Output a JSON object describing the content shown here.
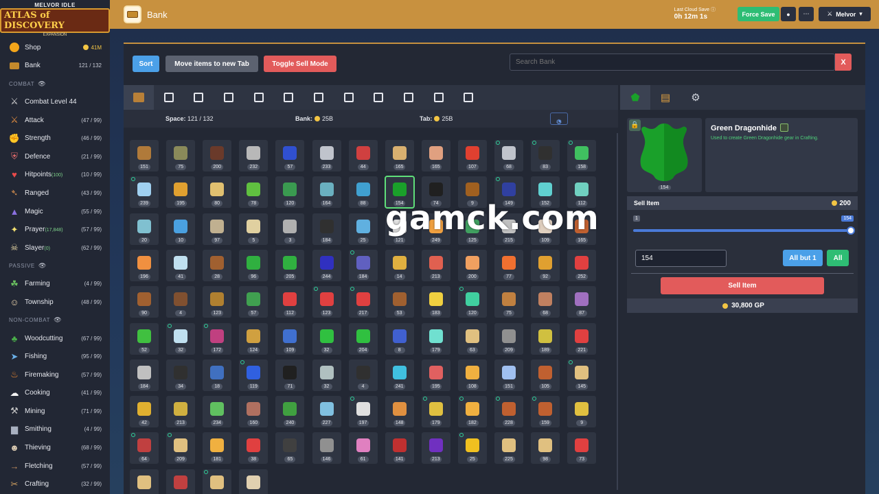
{
  "logo": {
    "top": "MELVOR IDLE",
    "main": "ATLAS of DISCOVERY",
    "sub": "EXPANSION"
  },
  "header": {
    "title": "Bank",
    "cloud_label": "Last Cloud Save",
    "cloud_time": "0h 12m 1s",
    "force_save": "Force Save",
    "menu_user": "Melvor"
  },
  "sidebar": {
    "shop": {
      "label": "Shop",
      "value": "41M"
    },
    "bank": {
      "label": "Bank",
      "value": "121 / 132"
    },
    "combat_head": "Combat",
    "combat_level": "Combat Level 44",
    "combat": [
      {
        "label": "Attack",
        "value": "(47 / 99)",
        "icon": "sword",
        "color": "#e89040"
      },
      {
        "label": "Strength",
        "value": "(46 / 99)",
        "icon": "arm",
        "color": "#f0b08a"
      },
      {
        "label": "Defence",
        "value": "(21 / 99)",
        "icon": "shield",
        "color": "#e06a6a"
      },
      {
        "label": "Hitpoints",
        "extra": "(100)",
        "value": "(10 / 99)",
        "icon": "heart",
        "color": "#e84a4a"
      },
      {
        "label": "Ranged",
        "value": "(43 / 99)",
        "icon": "bow",
        "color": "#d89050"
      },
      {
        "label": "Magic",
        "value": "(55 / 99)",
        "icon": "wizard",
        "color": "#8a70e0"
      },
      {
        "label": "Prayer",
        "extra": "(17,848)",
        "value": "(57 / 99)",
        "icon": "star",
        "color": "#f3e070"
      },
      {
        "label": "Slayer",
        "extra": "(0)",
        "value": "(62 / 99)",
        "icon": "slayer",
        "color": "#e0d0a0"
      }
    ],
    "passive_head": "Passive",
    "passive": [
      {
        "label": "Farming",
        "value": "(4 / 99)",
        "icon": "sprout",
        "color": "#6ac060"
      },
      {
        "label": "Township",
        "value": "(48 / 99)",
        "icon": "villager",
        "color": "#f0d8b0"
      }
    ],
    "noncombat_head": "Non-Combat",
    "noncombat": [
      {
        "label": "Woodcutting",
        "value": "(67 / 99)",
        "icon": "tree",
        "color": "#4ab04a"
      },
      {
        "label": "Fishing",
        "value": "(95 / 99)",
        "icon": "fish",
        "color": "#6ab0e8"
      },
      {
        "label": "Firemaking",
        "value": "(57 / 99)",
        "icon": "fire",
        "color": "#f08a30"
      },
      {
        "label": "Cooking",
        "value": "(41 / 99)",
        "icon": "chef",
        "color": "#f4f4f4"
      },
      {
        "label": "Mining",
        "value": "(71 / 99)",
        "icon": "pickaxe",
        "color": "#c8c8c8"
      },
      {
        "label": "Smithing",
        "value": "(4 / 99)",
        "icon": "anvil",
        "color": "#a8b0c0"
      },
      {
        "label": "Thieving",
        "value": "(68 / 99)",
        "icon": "thief",
        "color": "#d8c8b0"
      },
      {
        "label": "Fletching",
        "value": "(57 / 99)",
        "icon": "arrow",
        "color": "#c89060"
      },
      {
        "label": "Crafting",
        "value": "(32 / 99)",
        "icon": "crafting",
        "color": "#d0a060"
      }
    ]
  },
  "toolbar": {
    "sort": "Sort",
    "move": "Move items to new Tab",
    "sell_mode": "Toggle Sell Mode",
    "search_placeholder": "Search Bank",
    "clear": "X"
  },
  "info": {
    "space_label": "Space:",
    "space_value": "121 / 132",
    "bank_label": "Bank:",
    "bank_value": "25B",
    "tab_label": "Tab:",
    "tab_value": "25B"
  },
  "bank_tab_count": 12,
  "items": [
    {
      "q": "151",
      "c": "#b07a3a"
    },
    {
      "q": "75",
      "c": "#8a8a5a"
    },
    {
      "q": "200",
      "c": "#6a3a2a"
    },
    {
      "q": "232",
      "c": "#b8b8b8"
    },
    {
      "q": "57",
      "c": "#3050d0"
    },
    {
      "q": "233",
      "c": "#c0c4cc"
    },
    {
      "q": "44",
      "c": "#d04040"
    },
    {
      "q": "165",
      "c": "#d8b070"
    },
    {
      "q": "165",
      "c": "#e0a080"
    },
    {
      "q": "107",
      "c": "#e04030"
    },
    {
      "q": "68",
      "c": "#c0c4cc",
      "m": 1
    },
    {
      "q": "83",
      "c": "#303030",
      "m": 1
    },
    {
      "q": "158",
      "c": "#40c060",
      "m": 1
    },
    {
      "q": "239",
      "c": "#a0d0f0",
      "m": 1
    },
    {
      "q": "195",
      "c": "#e0a030"
    },
    {
      "q": "80",
      "c": "#e0c070"
    },
    {
      "q": "78",
      "c": "#60c040"
    },
    {
      "q": "120",
      "c": "#3a9a50"
    },
    {
      "q": "164",
      "c": "#6ab0c0"
    },
    {
      "q": "88",
      "c": "#40a0d0"
    },
    {
      "q": "154",
      "c": "#1aa02a",
      "sel": 1
    },
    {
      "q": "74",
      "c": "#202020"
    },
    {
      "q": "9",
      "c": "#a06020"
    },
    {
      "q": "149",
      "c": "#3040a0",
      "m": 1
    },
    {
      "q": "152",
      "c": "#60d0d0"
    },
    {
      "q": "112",
      "c": "#70d0c0"
    },
    {
      "q": "20",
      "c": "#80c0d0"
    },
    {
      "q": "10",
      "c": "#4aa0e0"
    },
    {
      "q": "97",
      "c": "#c0b090"
    },
    {
      "q": "5",
      "c": "#e0d0a0"
    },
    {
      "q": "3",
      "c": "#b0b0b0"
    },
    {
      "q": "184",
      "c": "#303030"
    },
    {
      "q": "25",
      "c": "#60b0e0"
    },
    {
      "q": "121",
      "c": "#e0e0e0"
    },
    {
      "q": "249",
      "c": "#f0a040"
    },
    {
      "q": "125",
      "c": "#40a060"
    },
    {
      "q": "215",
      "c": "#c0c0c0"
    },
    {
      "q": "109",
      "c": "#e0d0c0"
    },
    {
      "q": "165",
      "c": "#c06030"
    },
    {
      "q": "196",
      "c": "#f09040"
    },
    {
      "q": "41",
      "c": "#c0e0f0"
    },
    {
      "q": "28",
      "c": "#a06030"
    },
    {
      "q": "96",
      "c": "#30b040"
    },
    {
      "q": "205",
      "c": "#30b040"
    },
    {
      "q": "244",
      "c": "#3030c0"
    },
    {
      "q": "184",
      "c": "#6060c0",
      "m": 1
    },
    {
      "q": "14",
      "c": "#e0b040"
    },
    {
      "q": "213",
      "c": "#e06050"
    },
    {
      "q": "200",
      "c": "#f0a060"
    },
    {
      "q": "77",
      "c": "#f07030"
    },
    {
      "q": "92",
      "c": "#e0a030"
    },
    {
      "q": "252",
      "c": "#e04040"
    },
    {
      "q": "90",
      "c": "#a06030"
    },
    {
      "q": "4",
      "c": "#805030"
    },
    {
      "q": "123",
      "c": "#b08030"
    },
    {
      "q": "57",
      "c": "#40a050"
    },
    {
      "q": "112",
      "c": "#e04040"
    },
    {
      "q": "123",
      "c": "#e04040",
      "m": 1
    },
    {
      "q": "217",
      "c": "#e04040",
      "m": 1
    },
    {
      "q": "53",
      "c": "#a06030"
    },
    {
      "q": "183",
      "c": "#f0d040"
    },
    {
      "q": "120",
      "c": "#40d0a0",
      "m": 1
    },
    {
      "q": "75",
      "c": "#c08040"
    },
    {
      "q": "68",
      "c": "#c08060"
    },
    {
      "q": "87",
      "c": "#a070c0"
    },
    {
      "q": "52",
      "c": "#40c040"
    },
    {
      "q": "32",
      "c": "#c0e0f0",
      "m": 1
    },
    {
      "q": "172",
      "c": "#c04080",
      "m": 1
    },
    {
      "q": "124",
      "c": "#d0a040"
    },
    {
      "q": "109",
      "c": "#4070d0"
    },
    {
      "q": "32",
      "c": "#30c040"
    },
    {
      "q": "204",
      "c": "#30c040"
    },
    {
      "q": "8",
      "c": "#4060d0"
    },
    {
      "q": "179",
      "c": "#70e0d0"
    },
    {
      "q": "63",
      "c": "#e0c080"
    },
    {
      "q": "209",
      "c": "#909090"
    },
    {
      "q": "189",
      "c": "#d0c040"
    },
    {
      "q": "221",
      "c": "#e04040"
    },
    {
      "q": "184",
      "c": "#c0c0c0"
    },
    {
      "q": "34",
      "c": "#303030"
    },
    {
      "q": "18",
      "c": "#4070c0"
    },
    {
      "q": "119",
      "c": "#3060e0",
      "m": 1
    },
    {
      "q": "71",
      "c": "#202020"
    },
    {
      "q": "32",
      "c": "#b0c0c0"
    },
    {
      "q": "4",
      "c": "#303030"
    },
    {
      "q": "241",
      "c": "#40c0e0"
    },
    {
      "q": "195",
      "c": "#e06060"
    },
    {
      "q": "108",
      "c": "#f0b040"
    },
    {
      "q": "151",
      "c": "#a0c0f0"
    },
    {
      "q": "105",
      "c": "#c06030"
    },
    {
      "q": "145",
      "c": "#e0c080",
      "m": 1
    },
    {
      "q": "42",
      "c": "#e0b030"
    },
    {
      "q": "213",
      "c": "#d0b040"
    },
    {
      "q": "234",
      "c": "#60c060"
    },
    {
      "q": "160",
      "c": "#b07060"
    },
    {
      "q": "240",
      "c": "#40a040"
    },
    {
      "q": "227",
      "c": "#80c0e0"
    },
    {
      "q": "197",
      "c": "#e0e0e0",
      "m": 1
    },
    {
      "q": "148",
      "c": "#e09040"
    },
    {
      "q": "179",
      "c": "#e0c040",
      "m": 1
    },
    {
      "q": "182",
      "c": "#f0b040",
      "m": 1
    },
    {
      "q": "228",
      "c": "#c06030",
      "m": 1
    },
    {
      "q": "159",
      "c": "#c06030",
      "m": 1
    },
    {
      "q": "9",
      "c": "#e0c040"
    },
    {
      "q": "64",
      "c": "#c04040",
      "m": 1
    },
    {
      "q": "209",
      "c": "#e0c080",
      "m": 1
    },
    {
      "q": "181",
      "c": "#f0b040"
    },
    {
      "q": "38",
      "c": "#e04040"
    },
    {
      "q": "65",
      "c": "#404040"
    },
    {
      "q": "146",
      "c": "#909090"
    },
    {
      "q": "61",
      "c": "#e080c0"
    },
    {
      "q": "141",
      "c": "#c03030"
    },
    {
      "q": "213",
      "c": "#7030c0"
    },
    {
      "q": "25",
      "c": "#f0c020",
      "m": 1
    },
    {
      "q": "225",
      "c": "#e0c080"
    },
    {
      "q": "98",
      "c": "#e0c080"
    },
    {
      "q": "73",
      "c": "#e04040"
    },
    {
      "q": "",
      "c": "#e0c080"
    },
    {
      "q": "",
      "c": "#c04040"
    },
    {
      "q": "",
      "c": "#e0c080",
      "m": 1
    },
    {
      "q": "",
      "c": "#e0d0b0"
    }
  ],
  "right_panel": {
    "item_name": "Green Dragonhide",
    "item_desc": "Used to create Green Dragonhide gear in Crafting.",
    "preview_qty": "154",
    "sell_label": "Sell Item",
    "sell_price": "200",
    "slider_min": "1",
    "slider_max": "154",
    "qty_value": "154",
    "all_but_one": "All but 1",
    "all": "All",
    "sell_button": "Sell Item",
    "total": "30,800 GP"
  },
  "watermark": "gamck.com"
}
